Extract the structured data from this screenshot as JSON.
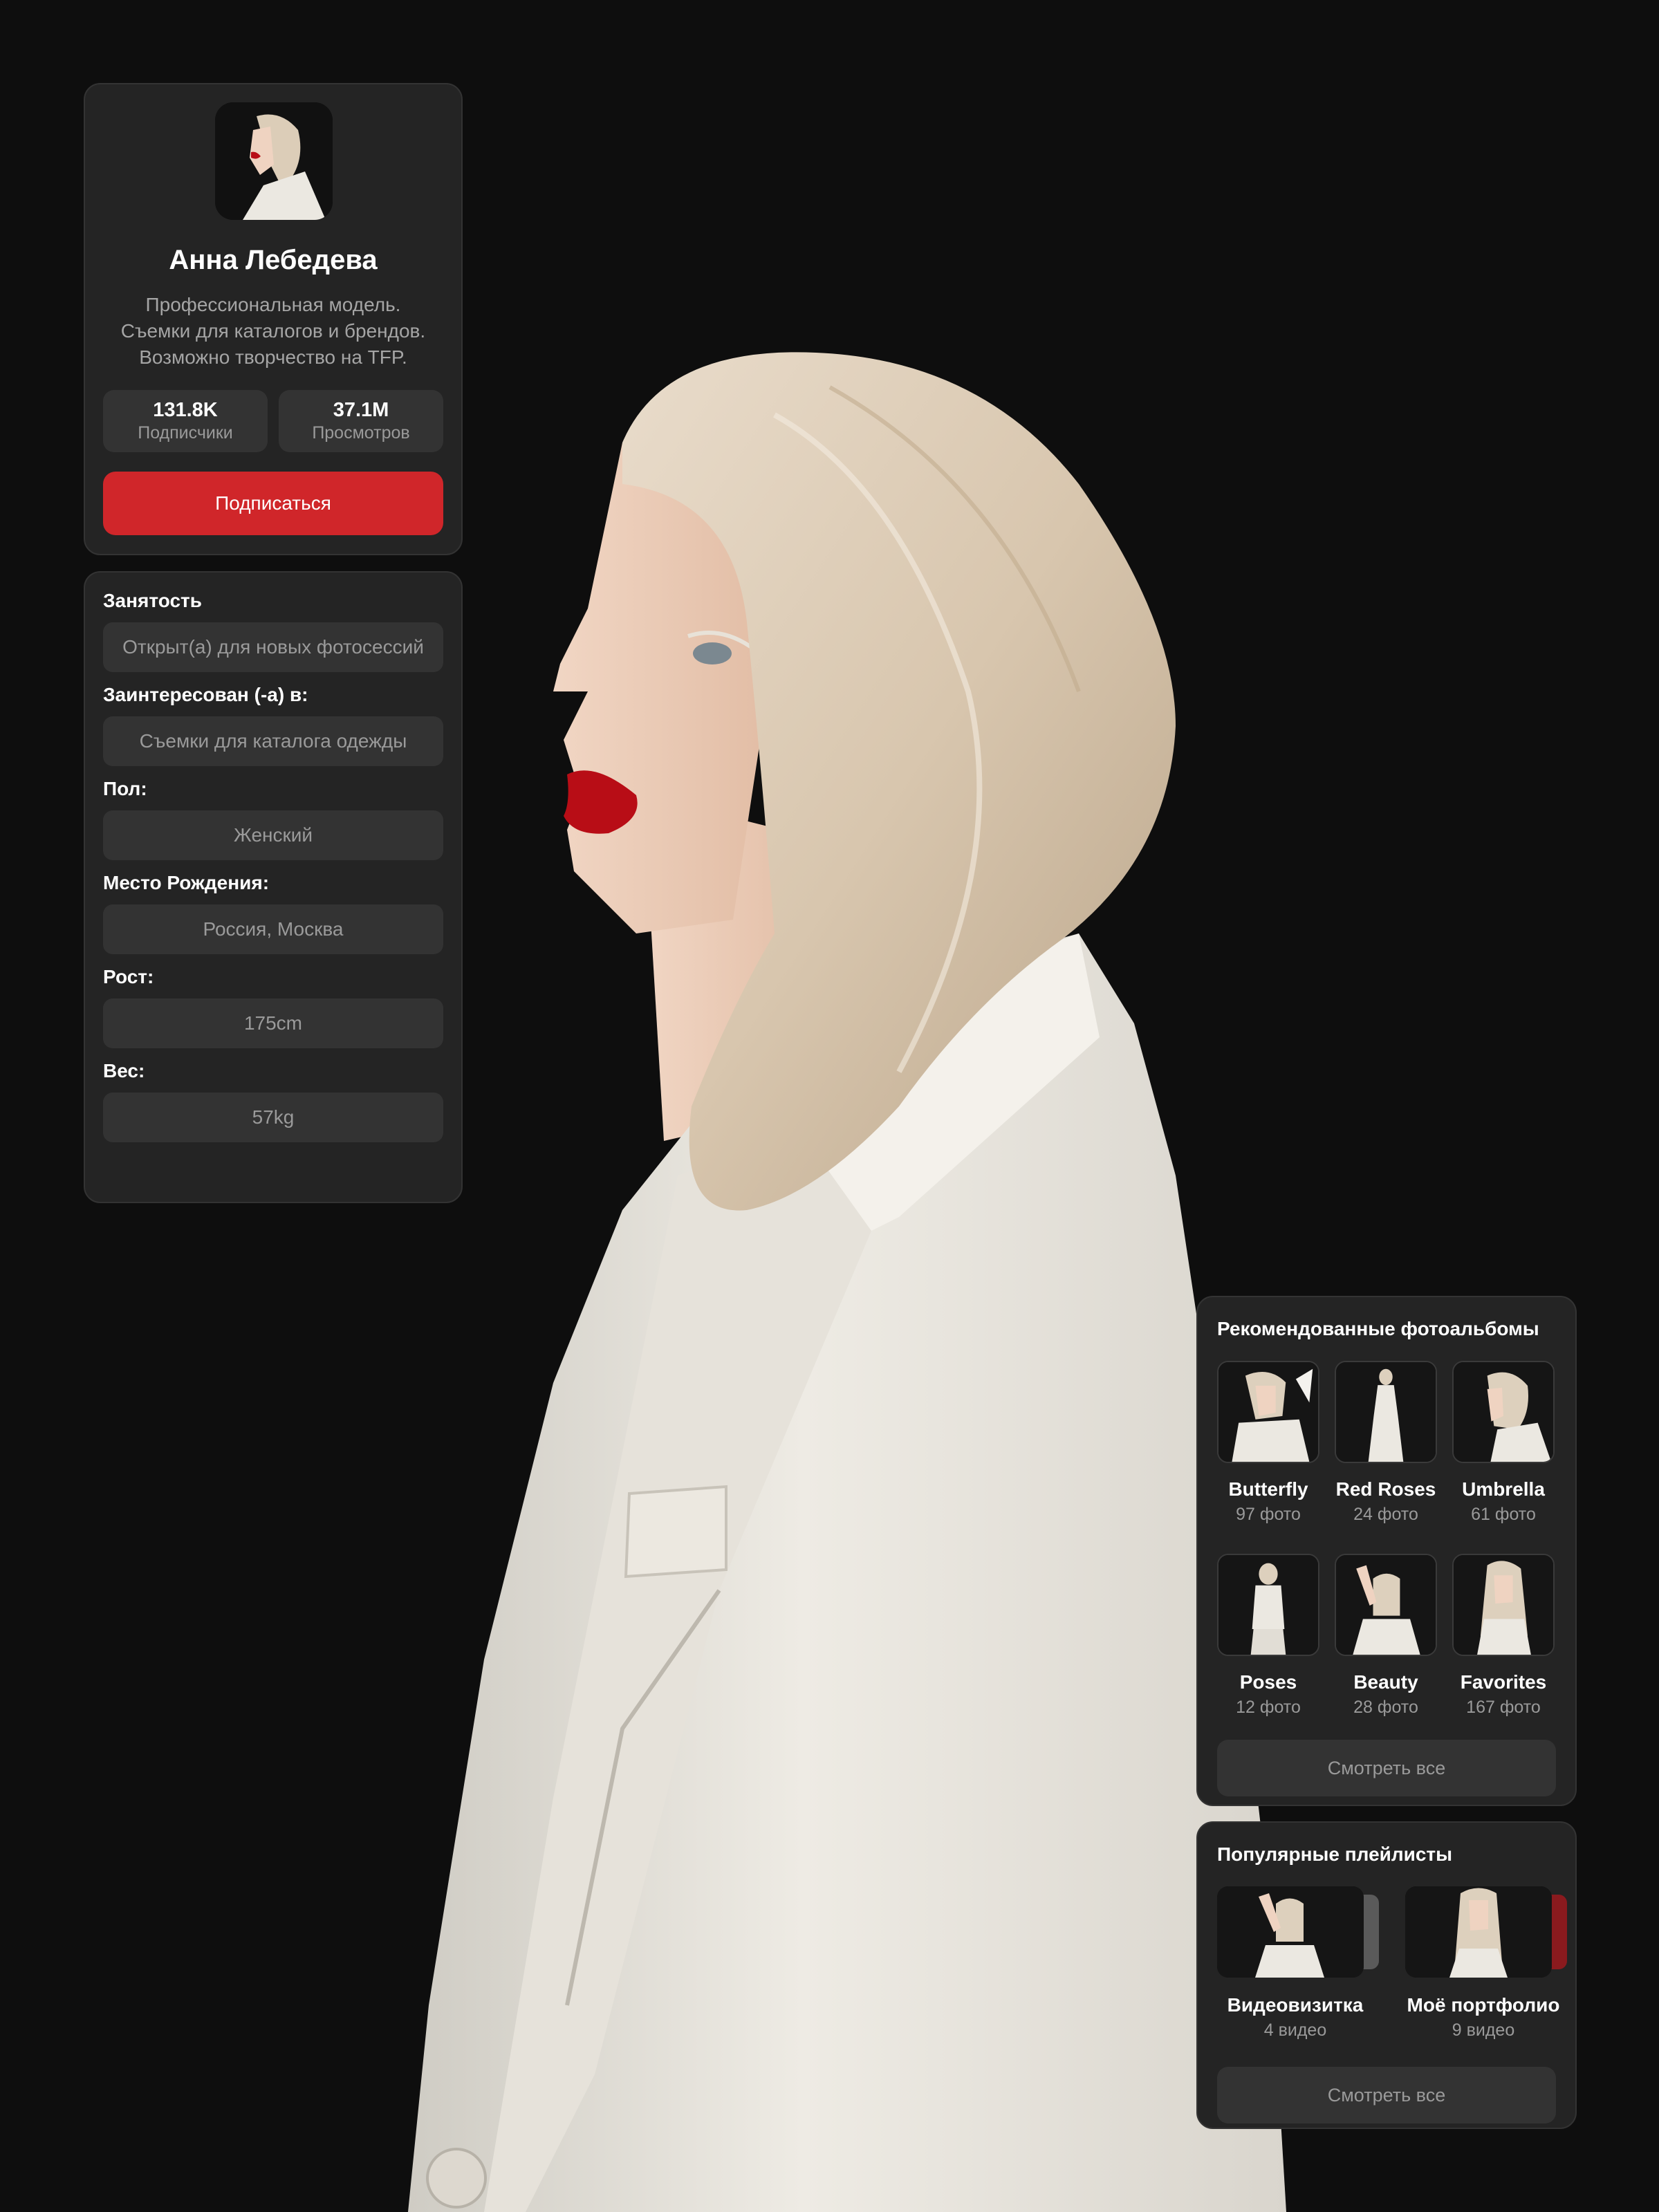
{
  "profile": {
    "name": "Анна Лебедева",
    "bio": [
      "Профессиональная модель.",
      "Съемки для каталогов и брендов.",
      "Возможно творчество на TFP."
    ],
    "stats": [
      {
        "value": "131.8K",
        "label": "Подписчики"
      },
      {
        "value": "37.1M",
        "label": "Просмотров"
      }
    ],
    "subscribe_label": "Подписаться"
  },
  "details": [
    {
      "label": "Занятость",
      "value": "Открыт(а) для новых фотосессий"
    },
    {
      "label": "Заинтересован (-а) в:",
      "value": "Съемки для каталога одежды"
    },
    {
      "label": "Пол:",
      "value": "Женский"
    },
    {
      "label": "Место Рождения:",
      "value": "Россия, Москва"
    },
    {
      "label": "Рост:",
      "value": "175cm"
    },
    {
      "label": "Вес:",
      "value": "57kg"
    }
  ],
  "albums": {
    "title": "Рекомендованные фотоальбомы",
    "items": [
      {
        "title": "Butterfly",
        "count": "97 фото"
      },
      {
        "title": "Red Roses",
        "count": "24 фото"
      },
      {
        "title": "Umbrella",
        "count": "61 фото"
      },
      {
        "title": "Poses",
        "count": "12 фото"
      },
      {
        "title": "Beauty",
        "count": "28 фото"
      },
      {
        "title": "Favorites",
        "count": "167 фото"
      }
    ],
    "see_all_label": "Смотреть все"
  },
  "playlists": {
    "title": "Популярные плейлисты",
    "items": [
      {
        "title": "Видеовизитка",
        "count": "4 видео"
      },
      {
        "title": "Моё портфолио",
        "count": "9 видео"
      }
    ],
    "see_all_label": "Смотреть все"
  },
  "colors": {
    "background": "#0e0e0e",
    "card": "#242424",
    "field": "#333333",
    "accent": "#d0262a",
    "muted_text": "#9a9a9a"
  }
}
